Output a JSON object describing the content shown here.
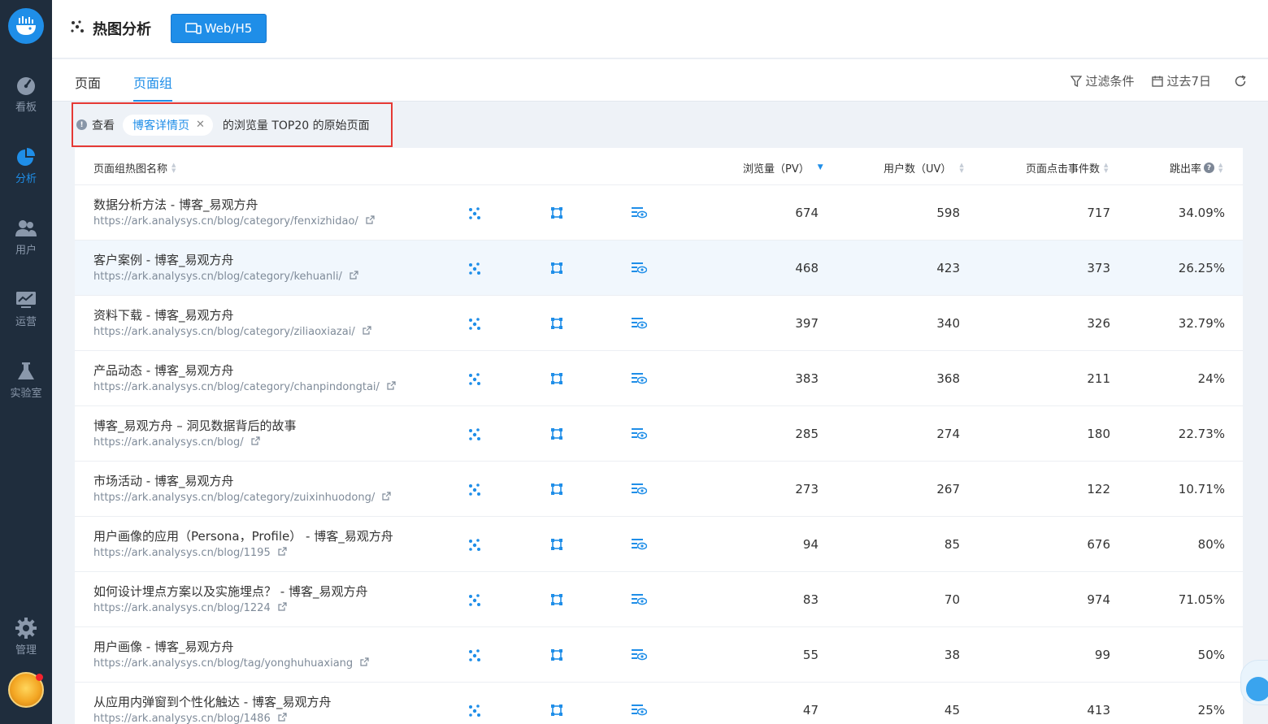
{
  "sidebar": {
    "items": [
      {
        "label": "看板",
        "icon": "dashboard-gauge-icon"
      },
      {
        "label": "分析",
        "icon": "pie-chart-icon",
        "active": true
      },
      {
        "label": "用户",
        "icon": "users-icon"
      },
      {
        "label": "运营",
        "icon": "monitor-chart-icon"
      },
      {
        "label": "实验室",
        "icon": "flask-icon"
      }
    ],
    "admin_label": "管理"
  },
  "header": {
    "title": "热图分析",
    "platform_button": "Web/H5"
  },
  "tabs": [
    {
      "label": "页面"
    },
    {
      "label": "页面组",
      "active": true
    }
  ],
  "tools": {
    "filter": "过滤条件",
    "date_range": "过去7日"
  },
  "filter_bar": {
    "prefix": "查看",
    "tag": "博客详情页",
    "suffix": "的浏览量 TOP20 的原始页面"
  },
  "table": {
    "headers": {
      "name": "页面组热图名称",
      "pv": "浏览量（PV）",
      "uv": "用户数（UV）",
      "clicks": "页面点击事件数",
      "bounce": "跳出率"
    },
    "rows": [
      {
        "name": "数据分析方法 - 博客_易观方舟",
        "url": "https://ark.analysys.cn/blog/category/fenxizhidao/",
        "pv": "674",
        "uv": "598",
        "clicks": "717",
        "bounce": "34.09%"
      },
      {
        "name": "客户案例 - 博客_易观方舟",
        "url": "https://ark.analysys.cn/blog/category/kehuanli/",
        "pv": "468",
        "uv": "423",
        "clicks": "373",
        "bounce": "26.25%"
      },
      {
        "name": "资料下载 - 博客_易观方舟",
        "url": "https://ark.analysys.cn/blog/category/ziliaoxiazai/",
        "pv": "397",
        "uv": "340",
        "clicks": "326",
        "bounce": "32.79%"
      },
      {
        "name": "产品动态 - 博客_易观方舟",
        "url": "https://ark.analysys.cn/blog/category/chanpindongtai/",
        "pv": "383",
        "uv": "368",
        "clicks": "211",
        "bounce": "24%"
      },
      {
        "name": "博客_易观方舟 – 洞见数据背后的故事",
        "url": "https://ark.analysys.cn/blog/",
        "pv": "285",
        "uv": "274",
        "clicks": "180",
        "bounce": "22.73%"
      },
      {
        "name": "市场活动 - 博客_易观方舟",
        "url": "https://ark.analysys.cn/blog/category/zuixinhuodong/",
        "pv": "273",
        "uv": "267",
        "clicks": "122",
        "bounce": "10.71%"
      },
      {
        "name": "用户画像的应用（Persona，Profile） - 博客_易观方舟",
        "url": "https://ark.analysys.cn/blog/1195",
        "pv": "94",
        "uv": "85",
        "clicks": "676",
        "bounce": "80%"
      },
      {
        "name": "如何设计埋点方案以及实施埋点？ - 博客_易观方舟",
        "url": "https://ark.analysys.cn/blog/1224",
        "pv": "83",
        "uv": "70",
        "clicks": "974",
        "bounce": "71.05%"
      },
      {
        "name": "用户画像 - 博客_易观方舟",
        "url": "https://ark.analysys.cn/blog/tag/yonghuhuaxiang",
        "pv": "55",
        "uv": "38",
        "clicks": "99",
        "bounce": "50%"
      },
      {
        "name": "从应用内弹窗到个性化触达 - 博客_易观方舟",
        "url": "https://ark.analysys.cn/blog/1486",
        "pv": "47",
        "uv": "45",
        "clicks": "413",
        "bounce": "25%"
      }
    ],
    "highlighted_row": 1
  },
  "colors": {
    "sidebar_bg": "#1f2d3d",
    "accent": "#1f8ee8",
    "highlight_border": "#e53935"
  }
}
